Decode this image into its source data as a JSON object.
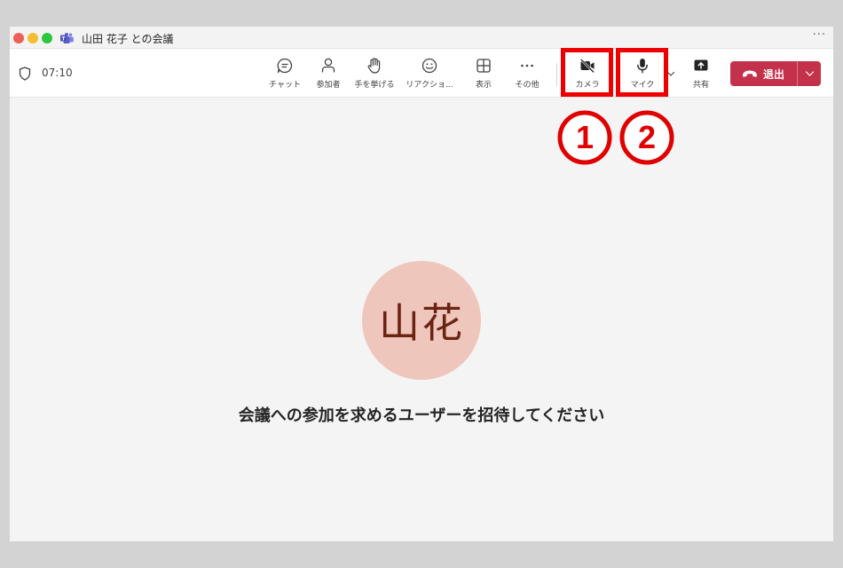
{
  "window": {
    "title": "山田 花子 との会議",
    "more_icon": "ellipsis-icon"
  },
  "toolbar": {
    "timer": "07:10",
    "buttons": [
      {
        "id": "chat",
        "label": "チャット",
        "icon": "chat-icon"
      },
      {
        "id": "participants",
        "label": "参加者",
        "icon": "people-icon"
      },
      {
        "id": "raise-hand",
        "label": "手を挙げる",
        "icon": "hand-icon"
      },
      {
        "id": "reactions",
        "label": "リアクショ...",
        "icon": "emoji-icon"
      },
      {
        "id": "view",
        "label": "表示",
        "icon": "grid-icon"
      },
      {
        "id": "more",
        "label": "その他",
        "icon": "ellipsis-icon"
      },
      {
        "id": "camera",
        "label": "カメラ",
        "icon": "video-off-icon"
      },
      {
        "id": "mic",
        "label": "マイク",
        "icon": "microphone-icon"
      },
      {
        "id": "share",
        "label": "共有",
        "icon": "share-icon"
      }
    ],
    "leave": {
      "label": "退出",
      "icon": "phone-hangup-icon"
    }
  },
  "annotations": {
    "badges": [
      "①",
      "②"
    ],
    "highlight_color": "#ee0000"
  },
  "stage": {
    "avatar_initials": "山花",
    "avatar_bg": "#efc6bb",
    "avatar_fg": "#6b2414",
    "message": "会議への参加を求めるユーザーを招待してください"
  },
  "colors": {
    "leave_red": "#c4314b",
    "teams_purple": "#5b5fc7"
  }
}
